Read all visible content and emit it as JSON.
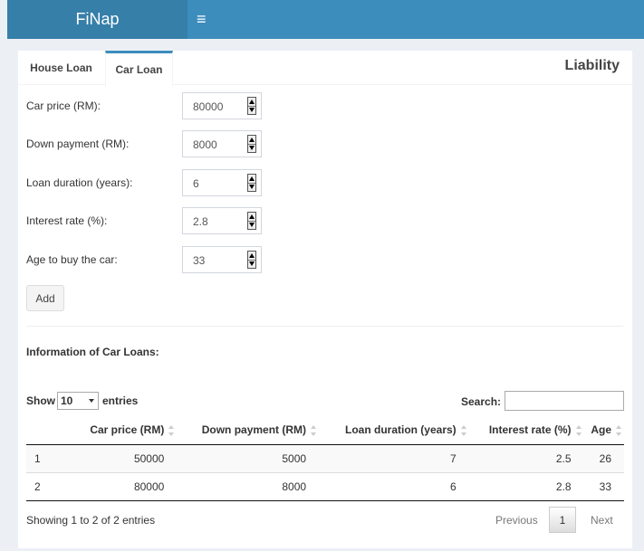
{
  "header": {
    "logo": "FiNap",
    "menu_icon": "hamburger-icon",
    "menu_glyph": "≡"
  },
  "tabs": [
    {
      "label": "House Loan"
    },
    {
      "label": "Car Loan",
      "active": true
    }
  ],
  "box_title": "Liability",
  "form": [
    {
      "label": "Car price (RM):",
      "value": "80000"
    },
    {
      "label": "Down payment (RM):",
      "value": "8000"
    },
    {
      "label": "Loan duration (years):",
      "value": "6"
    },
    {
      "label": "Interest rate (%):",
      "value": "2.8"
    },
    {
      "label": "Age to buy the car:",
      "value": "33"
    }
  ],
  "add_label": "Add",
  "info_title": "Information of Car Loans:",
  "show": {
    "prefix": "Show",
    "value": "10",
    "suffix": "entries"
  },
  "search": {
    "label": "Search:",
    "value": ""
  },
  "table": {
    "columns": [
      "",
      "Car price (RM)",
      "Down payment (RM)",
      "Loan duration (years)",
      "Interest rate (%)",
      "Age"
    ],
    "rows": [
      [
        "1",
        "50000",
        "5000",
        "7",
        "2.5",
        "26"
      ],
      [
        "2",
        "80000",
        "8000",
        "6",
        "2.8",
        "33"
      ]
    ]
  },
  "footer": {
    "info": "Showing 1 to 2 of 2 entries",
    "prev": "Previous",
    "page": "1",
    "next": "Next"
  },
  "colors": {
    "header": "#3c8dbc",
    "logo_bg": "#367fa9",
    "tab_accent": "#3c8dbc"
  }
}
